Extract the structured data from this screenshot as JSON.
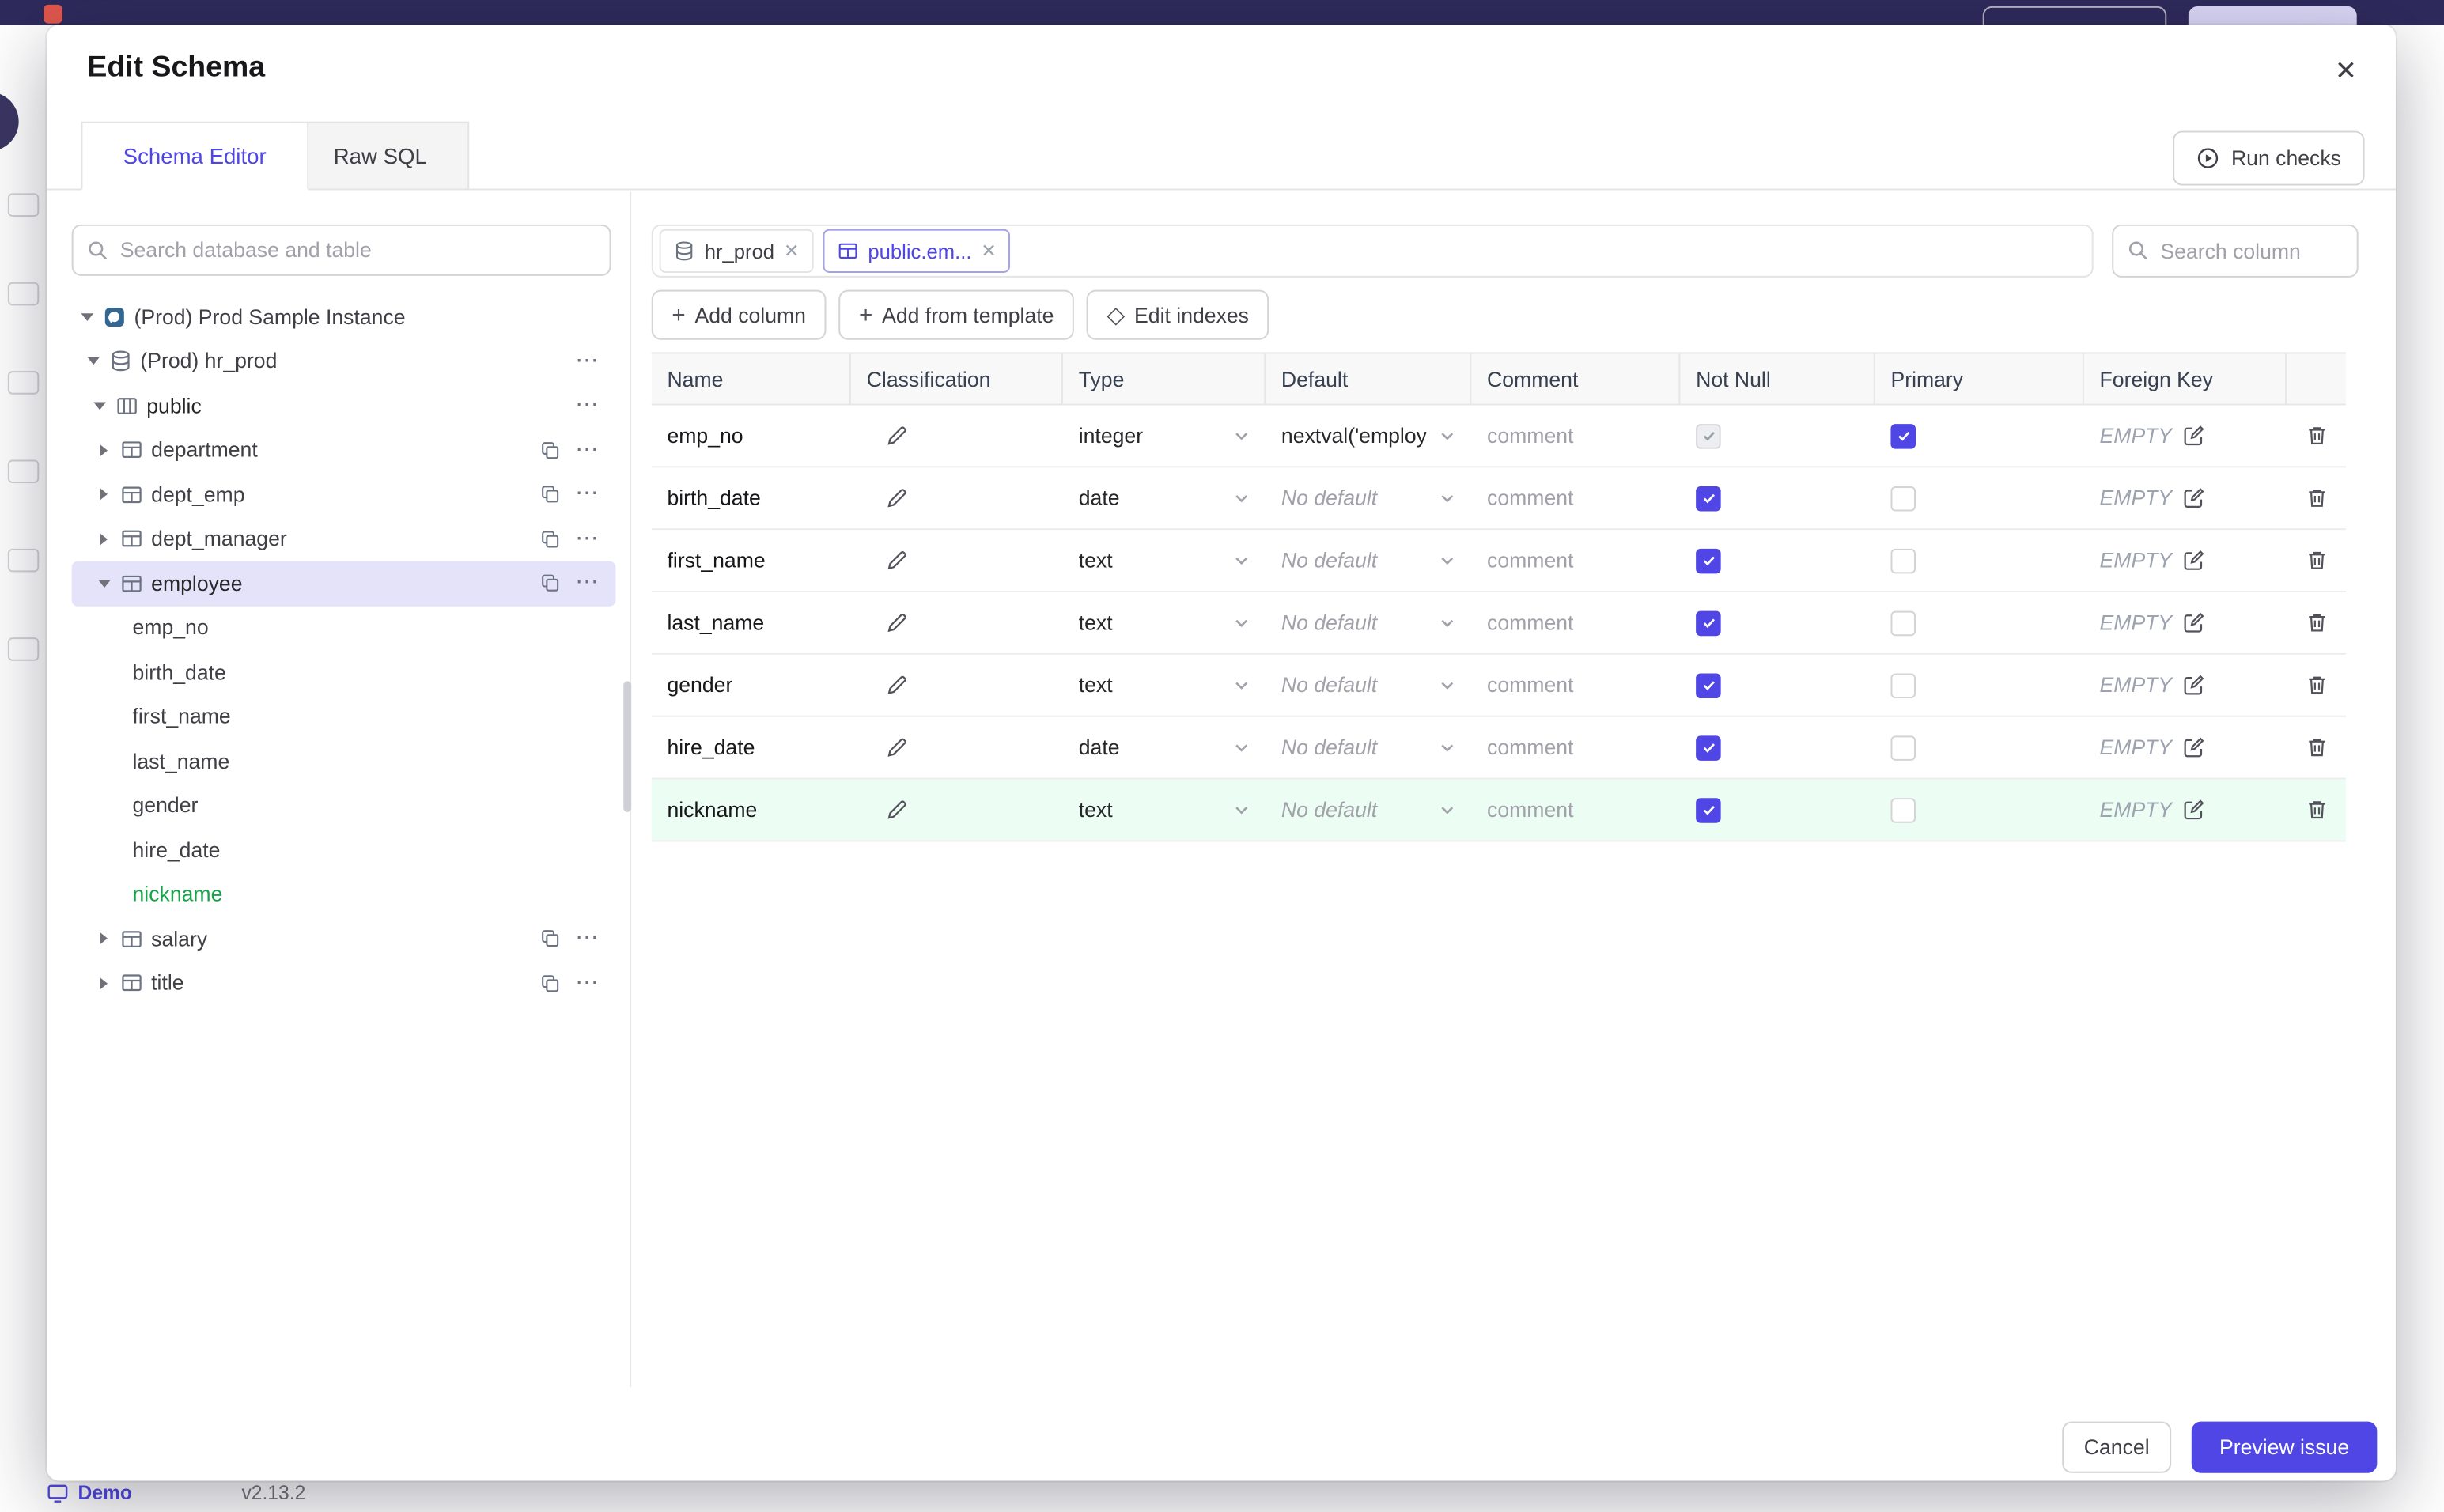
{
  "icons": {
    "plus": "+",
    "diamond": "◇",
    "more": "⋯",
    "close": "✕"
  },
  "colors": {
    "accent": "#4f46e5",
    "new_green": "#16a34a",
    "selected_bg": "#e4e3fa",
    "highlight_row": "#ecfdf3"
  },
  "page": {
    "footer": {
      "demo": "Demo",
      "version": "v2.13.2"
    }
  },
  "modal": {
    "title": "Edit Schema",
    "tabs": [
      {
        "label": "Schema Editor",
        "active": true
      },
      {
        "label": "Raw SQL",
        "active": false
      }
    ],
    "run_checks_label": "Run checks",
    "sidebar": {
      "search_placeholder": "Search database and table",
      "tree": [
        {
          "label": "(Prod) Prod Sample Instance"
        },
        {
          "label": "(Prod) hr_prod"
        },
        {
          "label": "public"
        },
        {
          "label": "department"
        },
        {
          "label": "dept_emp"
        },
        {
          "label": "dept_manager"
        },
        {
          "label": "employee",
          "selected": true
        },
        {
          "label": "emp_no"
        },
        {
          "label": "birth_date"
        },
        {
          "label": "first_name"
        },
        {
          "label": "last_name"
        },
        {
          "label": "gender"
        },
        {
          "label": "hire_date"
        },
        {
          "label": "nickname",
          "new": true
        },
        {
          "label": "salary"
        },
        {
          "label": "title"
        }
      ]
    },
    "main": {
      "chips": [
        {
          "label": "hr_prod",
          "active": false
        },
        {
          "label": "public.em...",
          "active": true
        }
      ],
      "column_search_placeholder": "Search column",
      "toolbar": {
        "add_column": "Add column",
        "add_from_template": "Add from template",
        "edit_indexes": "Edit indexes"
      },
      "table": {
        "headers": [
          "Name",
          "Classification",
          "Type",
          "Default",
          "Comment",
          "Not Null",
          "Primary",
          "Foreign Key"
        ],
        "rows": [
          {
            "name": "emp_no",
            "type": "integer",
            "default": "nextval('employ",
            "default_is_placeholder": false,
            "comment_placeholder": "comment",
            "not_null_checked": true,
            "not_null_disabled": true,
            "primary_checked": true,
            "foreign_key": "EMPTY"
          },
          {
            "name": "birth_date",
            "type": "date",
            "default": "No default",
            "default_is_placeholder": true,
            "comment_placeholder": "comment",
            "not_null_checked": true,
            "not_null_disabled": false,
            "primary_checked": false,
            "foreign_key": "EMPTY"
          },
          {
            "name": "first_name",
            "type": "text",
            "default": "No default",
            "default_is_placeholder": true,
            "comment_placeholder": "comment",
            "not_null_checked": true,
            "not_null_disabled": false,
            "primary_checked": false,
            "foreign_key": "EMPTY"
          },
          {
            "name": "last_name",
            "type": "text",
            "default": "No default",
            "default_is_placeholder": true,
            "comment_placeholder": "comment",
            "not_null_checked": true,
            "not_null_disabled": false,
            "primary_checked": false,
            "foreign_key": "EMPTY"
          },
          {
            "name": "gender",
            "type": "text",
            "default": "No default",
            "default_is_placeholder": true,
            "comment_placeholder": "comment",
            "not_null_checked": true,
            "not_null_disabled": false,
            "primary_checked": false,
            "foreign_key": "EMPTY"
          },
          {
            "name": "hire_date",
            "type": "date",
            "default": "No default",
            "default_is_placeholder": true,
            "comment_placeholder": "comment",
            "not_null_checked": true,
            "not_null_disabled": false,
            "primary_checked": false,
            "foreign_key": "EMPTY"
          },
          {
            "name": "nickname",
            "type": "text",
            "default": "No default",
            "default_is_placeholder": true,
            "comment_placeholder": "comment",
            "not_null_checked": true,
            "not_null_disabled": false,
            "primary_checked": false,
            "foreign_key": "EMPTY",
            "highlight": true
          }
        ]
      }
    },
    "footer": {
      "cancel": "Cancel",
      "submit": "Preview issue"
    }
  }
}
